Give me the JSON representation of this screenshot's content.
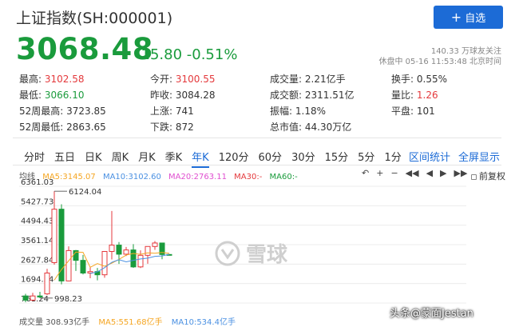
{
  "header": {
    "title": "上证指数(SH:000001)",
    "add_button_label": "自选",
    "price": "3068.48",
    "change": "-15.80",
    "change_pct": "-0.51%",
    "followers": "140.33 万球友关注",
    "status": "休盘中 05-16 11:53:48 北京时间"
  },
  "quotes": [
    [
      {
        "label": "最高:",
        "value": "3102.58",
        "tone": "red"
      },
      {
        "label": "今开:",
        "value": "3100.55",
        "tone": "red"
      },
      {
        "label": "成交量:",
        "value": "2.21亿手",
        "tone": "normal"
      },
      {
        "label": "换手:",
        "value": "0.55%",
        "tone": "normal"
      }
    ],
    [
      {
        "label": "最低:",
        "value": "3066.10",
        "tone": "green"
      },
      {
        "label": "昨收:",
        "value": "3084.28",
        "tone": "normal"
      },
      {
        "label": "成交额:",
        "value": "2311.51亿",
        "tone": "normal"
      },
      {
        "label": "量比:",
        "value": "1.26",
        "tone": "red"
      }
    ],
    [
      {
        "label": "52周最高:",
        "value": "3723.85",
        "tone": "normal"
      },
      {
        "label": "上涨:",
        "value": "741",
        "tone": "normal"
      },
      {
        "label": "振幅:",
        "value": "1.18%",
        "tone": "normal"
      },
      {
        "label": "平盘:",
        "value": "101",
        "tone": "normal"
      }
    ],
    [
      {
        "label": "52周最低:",
        "value": "2863.65",
        "tone": "normal"
      },
      {
        "label": "下跌:",
        "value": "872",
        "tone": "normal"
      },
      {
        "label": "总市值:",
        "value": "44.30万亿",
        "tone": "normal"
      },
      {
        "label": "",
        "value": "",
        "tone": "normal"
      }
    ]
  ],
  "tabs": [
    "分时",
    "五日",
    "日K",
    "周K",
    "月K",
    "季K",
    "年K",
    "120分",
    "60分",
    "30分",
    "15分",
    "5分",
    "1分"
  ],
  "active_tab": "年K",
  "tab_links": {
    "stats": "区间统计",
    "fullscreen": "全屏显示"
  },
  "ma_legend": {
    "label": "均线",
    "ma5": "MA5:3145.07",
    "ma10": "MA10:3102.60",
    "ma20": "MA20:2763.11",
    "ma30": "MA30:-",
    "ma60": "MA60:-"
  },
  "tools": {
    "restore": "前复权"
  },
  "volume_legend": {
    "volume": "成交量 308.93亿手",
    "ma5": "MA5:551.68亿手",
    "ma10": "MA10:534.4亿手"
  },
  "watermark": "雪球",
  "signature": "头条@蒙面Jestan",
  "colors": {
    "up": "#e4393c",
    "down": "#1a9b3c",
    "accent": "#1c6bd6",
    "ma5": "#f5a623",
    "ma10": "#4a90e2",
    "ma20": "#e04fd0"
  },
  "chart_data": {
    "type": "candlestick",
    "y_ticks": [
      "6361.03",
      "5427.73",
      "4494.43",
      "3561.14",
      "2627.84",
      "1694.54",
      "761.24"
    ],
    "ylim": [
      761.24,
      6361.03
    ],
    "annotations": {
      "high": "6124.04",
      "low": "998.23"
    },
    "candles": [
      {
        "o": 1100,
        "c": 900,
        "h": 1200,
        "l": 800
      },
      {
        "o": 900,
        "c": 1100,
        "h": 1250,
        "l": 850
      },
      {
        "o": 1100,
        "c": 1050,
        "h": 1300,
        "l": 998
      },
      {
        "o": 1200,
        "c": 2200,
        "h": 2400,
        "l": 1150
      },
      {
        "o": 2700,
        "c": 5262,
        "h": 6124,
        "l": 2600
      },
      {
        "o": 5262,
        "c": 1820,
        "h": 5500,
        "l": 1660
      },
      {
        "o": 1820,
        "c": 3277,
        "h": 3480,
        "l": 1800
      },
      {
        "o": 3277,
        "c": 2808,
        "h": 3300,
        "l": 2300
      },
      {
        "o": 2808,
        "c": 2199,
        "h": 3067,
        "l": 2132
      },
      {
        "o": 2199,
        "c": 2269,
        "h": 2478,
        "l": 1949
      },
      {
        "o": 2269,
        "c": 2116,
        "h": 2444,
        "l": 1849
      },
      {
        "o": 2116,
        "c": 3235,
        "h": 3239,
        "l": 1975
      },
      {
        "o": 3235,
        "c": 3539,
        "h": 5178,
        "l": 2850
      },
      {
        "o": 3539,
        "c": 3104,
        "h": 3684,
        "l": 2638
      },
      {
        "o": 3104,
        "c": 3307,
        "h": 3450,
        "l": 3016
      },
      {
        "o": 3307,
        "c": 2494,
        "h": 3587,
        "l": 2449
      },
      {
        "o": 2494,
        "c": 3050,
        "h": 3288,
        "l": 2440
      },
      {
        "o": 3050,
        "c": 3473,
        "h": 3474,
        "l": 2647
      },
      {
        "o": 3473,
        "c": 3640,
        "h": 3732,
        "l": 3312
      },
      {
        "o": 3640,
        "c": 3089,
        "h": 3424,
        "l": 2863
      },
      {
        "o": 3089,
        "c": 3068,
        "h": 3102,
        "l": 3066
      }
    ],
    "ma5": [
      null,
      null,
      null,
      null,
      1860,
      2367,
      2789,
      3207,
      3193,
      2474,
      2653,
      2525,
      2672,
      2853,
      3060,
      3140,
      3098,
      3166,
      3150,
      3189,
      3145
    ],
    "ma10": [
      null,
      null,
      null,
      null,
      null,
      null,
      null,
      null,
      null,
      2177,
      2260,
      2456,
      2717,
      2839,
      2735,
      2809,
      2875,
      2916,
      3001,
      3021,
      3102
    ]
  }
}
